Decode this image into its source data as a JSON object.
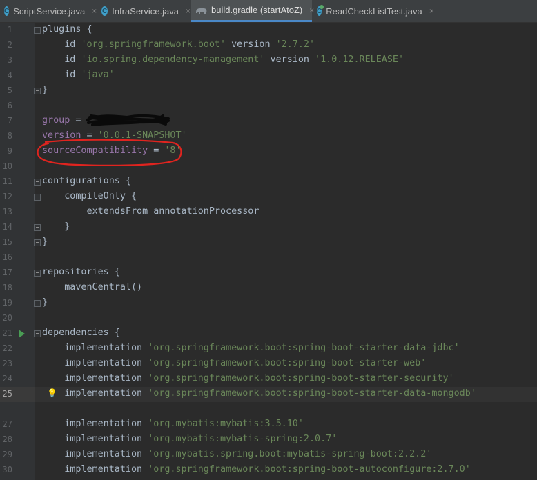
{
  "tabs": [
    {
      "label": "ScriptService.java",
      "icon": "java-class-icon",
      "active": false
    },
    {
      "label": "InfraService.java",
      "icon": "java-class-icon",
      "active": false
    },
    {
      "label": "build.gradle (startAtoZ)",
      "icon": "gradle-elephant-icon",
      "active": true
    },
    {
      "label": "ReadCheckListTest.java",
      "icon": "java-test-class-icon",
      "active": false
    }
  ],
  "close_glyph": "×",
  "current_line": 25,
  "lines": [
    {
      "n": "1",
      "segs": [
        [
          "plugins {",
          "p"
        ]
      ]
    },
    {
      "n": "2",
      "segs": [
        [
          "    id ",
          "p"
        ],
        [
          "'org.springframework.boot'",
          "s"
        ],
        [
          " version ",
          "p"
        ],
        [
          "'2.7.2'",
          "s"
        ]
      ]
    },
    {
      "n": "3",
      "segs": [
        [
          "    id ",
          "p"
        ],
        [
          "'io.spring.dependency-management'",
          "s"
        ],
        [
          " version ",
          "p"
        ],
        [
          "'1.0.12.RELEASE'",
          "s"
        ]
      ]
    },
    {
      "n": "4",
      "segs": [
        [
          "    id ",
          "p"
        ],
        [
          "'java'",
          "s"
        ]
      ]
    },
    {
      "n": "5",
      "segs": [
        [
          "}",
          "p"
        ]
      ]
    },
    {
      "n": "6",
      "segs": []
    },
    {
      "n": "7",
      "segs": [
        [
          "group",
          "v"
        ],
        [
          " = ",
          "p"
        ]
      ]
    },
    {
      "n": "8",
      "segs": [
        [
          "version",
          "v"
        ],
        [
          " = ",
          "p"
        ],
        [
          "'0.0.1-SNAPSHOT'",
          "s"
        ]
      ]
    },
    {
      "n": "9",
      "segs": [
        [
          "sourceCompatibility",
          "v"
        ],
        [
          " = ",
          "p"
        ],
        [
          "'8'",
          "s"
        ]
      ]
    },
    {
      "n": "10",
      "segs": []
    },
    {
      "n": "11",
      "segs": [
        [
          "configurations {",
          "p"
        ]
      ]
    },
    {
      "n": "12",
      "segs": [
        [
          "    compileOnly {",
          "p"
        ]
      ]
    },
    {
      "n": "13",
      "segs": [
        [
          "        extendsFrom annotationProcessor",
          "p"
        ]
      ]
    },
    {
      "n": "14",
      "segs": [
        [
          "    }",
          "p"
        ]
      ]
    },
    {
      "n": "15",
      "segs": [
        [
          "}",
          "p"
        ]
      ]
    },
    {
      "n": "16",
      "segs": []
    },
    {
      "n": "17",
      "segs": [
        [
          "repositories {",
          "p"
        ]
      ]
    },
    {
      "n": "18",
      "segs": [
        [
          "    mavenCentral()",
          "p"
        ]
      ]
    },
    {
      "n": "19",
      "segs": [
        [
          "}",
          "p"
        ]
      ]
    },
    {
      "n": "20",
      "segs": []
    },
    {
      "n": "21",
      "segs": [
        [
          "dependencies {",
          "p"
        ]
      ]
    },
    {
      "n": "22",
      "segs": [
        [
          "    implementation ",
          "p"
        ],
        [
          "'org.springframework.boot:spring-boot-starter-data-jdbc'",
          "s"
        ]
      ]
    },
    {
      "n": "23",
      "segs": [
        [
          "    implementation ",
          "p"
        ],
        [
          "'org.springframework.boot:spring-boot-starter-web'",
          "s"
        ]
      ]
    },
    {
      "n": "24",
      "segs": [
        [
          "    implementation ",
          "p"
        ],
        [
          "'org.springframework.boot:spring-boot-starter-security'",
          "s"
        ]
      ]
    },
    {
      "n": "25",
      "segs": [
        [
          "    implementation ",
          "p"
        ],
        [
          "'org.springframework.boot:spring-boot-starter-data-mongodb'",
          "s"
        ]
      ]
    },
    {
      "n": "",
      "segs": []
    },
    {
      "n": "27",
      "segs": [
        [
          "    implementation ",
          "p"
        ],
        [
          "'org.mybatis:mybatis:3.5.10'",
          "s"
        ]
      ]
    },
    {
      "n": "28",
      "segs": [
        [
          "    implementation ",
          "p"
        ],
        [
          "'org.mybatis:mybatis-spring:2.0.7'",
          "s"
        ]
      ]
    },
    {
      "n": "29",
      "segs": [
        [
          "    implementation ",
          "p"
        ],
        [
          "'org.mybatis.spring.boot:mybatis-spring-boot:2.2.2'",
          "s"
        ]
      ]
    },
    {
      "n": "30",
      "segs": [
        [
          "    implementation ",
          "p"
        ],
        [
          "'org.springframework.boot:spring-boot-autoconfigure:2.7.0'",
          "s"
        ]
      ]
    }
  ],
  "colors": {
    "editor_bg": "#2b2b2b",
    "string": "#6a8759",
    "property": "#9876aa",
    "plain": "#a9b7c6",
    "annotation_red": "#e0241f"
  }
}
